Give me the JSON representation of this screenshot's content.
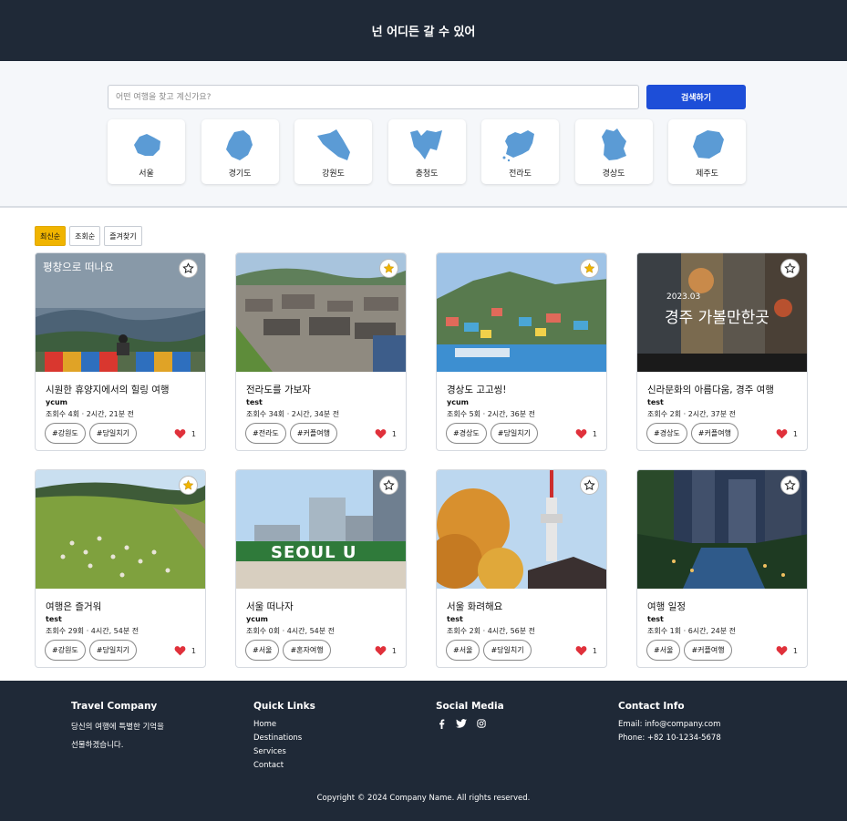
{
  "header": {
    "title": "넌 어디든 갈 수 있어"
  },
  "search": {
    "placeholder": "어떤 여행을 찾고 계신가요?",
    "button_label": "검색하기"
  },
  "regions": [
    {
      "label": "서울"
    },
    {
      "label": "경기도"
    },
    {
      "label": "강원도"
    },
    {
      "label": "충청도"
    },
    {
      "label": "전라도"
    },
    {
      "label": "경상도"
    },
    {
      "label": "제주도"
    }
  ],
  "sort_tabs": [
    {
      "label": "최신순",
      "active": true
    },
    {
      "label": "조회순"
    },
    {
      "label": "즐겨찾기"
    }
  ],
  "cards": [
    {
      "title": "시원한 휴양지에서의 힐링 여행",
      "author": "ycum",
      "meta": "조회수 4회 · 2시간, 21분 전",
      "tags": [
        "#강원도",
        "#당일치기"
      ],
      "likes": "1",
      "starred": false,
      "overlay_text": "평창으로 떠나요"
    },
    {
      "title": "전라도를 가보자",
      "author": "test",
      "meta": "조회수 34회 · 2시간, 34분 전",
      "tags": [
        "#전라도",
        "#커플여행"
      ],
      "likes": "1",
      "starred": true
    },
    {
      "title": "경상도 고고씽!",
      "author": "ycum",
      "meta": "조회수 5회 · 2시간, 36분 전",
      "tags": [
        "#경상도",
        "#당일치기"
      ],
      "likes": "1",
      "starred": true
    },
    {
      "title": "신라문화의 아름다움, 경주 여행",
      "author": "test",
      "meta": "조회수 2회 · 2시간, 37분 전",
      "tags": [
        "#경상도",
        "#커플여행"
      ],
      "likes": "1",
      "starred": false,
      "overlay_text": "경주 가볼만한곳",
      "overlay_sub": "2023.03"
    },
    {
      "title": "여행은 즐거워",
      "author": "test",
      "meta": "조회수 29회 · 4시간, 54분 전",
      "tags": [
        "#강원도",
        "#당일치기"
      ],
      "likes": "1",
      "starred": true
    },
    {
      "title": "서울 떠나자",
      "author": "ycum",
      "meta": "조회수 0회 · 4시간, 54분 전",
      "tags": [
        "#서울",
        "#혼자여행"
      ],
      "likes": "1",
      "starred": false,
      "overlay_text": "SEOUL U"
    },
    {
      "title": "서울 화려해요",
      "author": "test",
      "meta": "조회수 2회 · 4시간, 56분 전",
      "tags": [
        "#서울",
        "#당일치기"
      ],
      "likes": "1",
      "starred": false
    },
    {
      "title": "여행 일정",
      "author": "test",
      "meta": "조회수 1회 · 6시간, 24분 전",
      "tags": [
        "#서울",
        "#커플여행"
      ],
      "likes": "1",
      "starred": false
    }
  ],
  "footer": {
    "company": {
      "title": "Travel Company",
      "line1": "당신의 여행에 특별한 기억을",
      "line2": "선물하겠습니다."
    },
    "links": {
      "title": "Quick Links",
      "items": [
        "Home",
        "Destinations",
        "Services",
        "Contact"
      ]
    },
    "social": {
      "title": "Social Media",
      "icons": [
        "facebook-icon",
        "twitter-icon",
        "instagram-icon"
      ]
    },
    "contact": {
      "title": "Contact Info",
      "email": "Email: info@company.com",
      "phone": "Phone: +82 10-1234-5678"
    },
    "copyright": "Copyright © 2024 Company Name. All rights reserved."
  },
  "colors": {
    "header_bg": "#1f2937",
    "accent_blue": "#1d4ed8",
    "active_tab": "#f0b400",
    "star": "#f0b400",
    "heart": "#e0313b"
  }
}
